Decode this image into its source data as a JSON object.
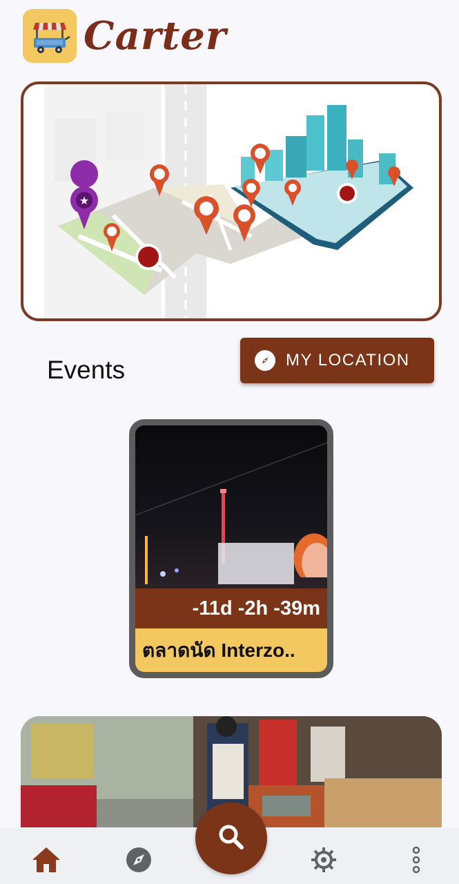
{
  "app": {
    "brand": "Carter"
  },
  "events_section": {
    "title": "Events"
  },
  "location_button": {
    "label": "MY LOCATION"
  },
  "event_card": {
    "countdown": "-11d -2h -39m",
    "name": "ตลาดนัด Interzo.."
  },
  "colors": {
    "brand_brown": "#7b3417",
    "accent_yellow": "#f4c861",
    "card_border": "#5c5c5c"
  },
  "icons": {
    "logo": "food-cart-icon",
    "location_button": "compass-icon",
    "nav": [
      "home-icon",
      "compass-icon",
      "search-icon",
      "gear-icon",
      "more-vertical-icon"
    ]
  }
}
